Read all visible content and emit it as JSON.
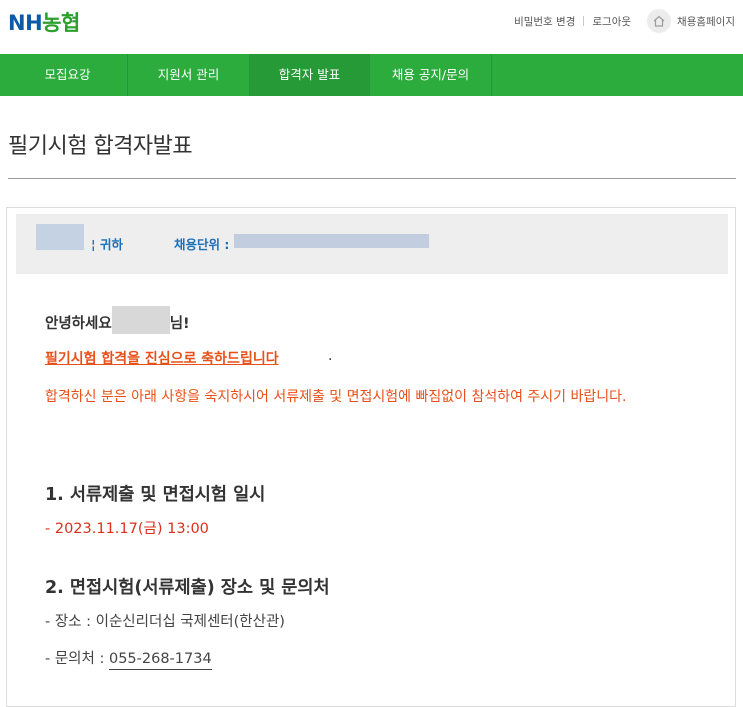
{
  "header": {
    "logo_nh": "NH",
    "logo_kr": "농협",
    "links": [
      "비밀번호 변경",
      "로그아웃",
      "채용홈페이지"
    ],
    "home_icon": "home-icon"
  },
  "nav": {
    "items": [
      "모집요강",
      "지원서 관리",
      "합격자 발표",
      "채용 공지/문의"
    ],
    "active": "합격자 발표"
  },
  "page": {
    "title": "필기시험 합격자발표"
  },
  "info_bar": {
    "suffix": "귀하",
    "unit_label": "채용단위 :"
  },
  "message": {
    "greeting_prefix": "안녕하세요",
    "greeting_suffix": "님!",
    "congrats": "필기시험 합격을 진심으로 축하드립니다",
    "congrats_tail": ".",
    "notice": "합격하신 분은 아래 사항을 숙지하시어 서류제출 및 면접시험에 빠짐없이 참석하여 주시기 바랍니다."
  },
  "section1": {
    "title": "1. 서류제출 및 면접시험 일시",
    "datetime": "- 2023.11.17(금) 13:00"
  },
  "section2": {
    "title": "2. 면접시험(서류제출) 장소 및 문의처",
    "place": "- 장소 : 이순신리더십 국제센터(한산관)",
    "contact_label": "- 문의처 : ",
    "contact_phone": "055-268-1734"
  },
  "colors": {
    "nav_green": "#2bac3d",
    "accent_orange": "#e8501a",
    "date_red": "#d9301c",
    "link_blue": "#1d6fb8"
  }
}
